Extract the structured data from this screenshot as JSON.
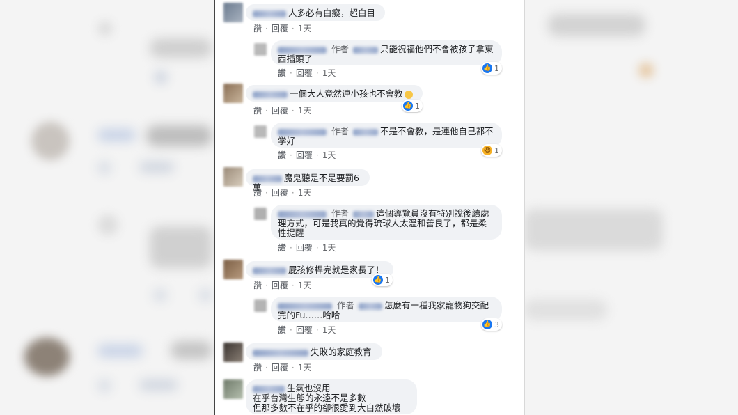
{
  "colors": {
    "like": "#1877f2",
    "haha": "#f7b125",
    "bubble": "#f0f2f5",
    "muted": "#65676b"
  },
  "actions": {
    "like": "讚",
    "reply": "回覆",
    "time": "1天",
    "sep": "·"
  },
  "author_badge": "作者",
  "comments": [
    {
      "text": "人多必有白癡，超白目"
    },
    {
      "text": "只能祝福他們不會被孩子拿東西插頭了",
      "reaction_count": "1"
    },
    {
      "text": "一個大人竟然連小孩也不會教",
      "reaction_count": "1"
    },
    {
      "text": "不是不會教，是連他自己都不学好",
      "reaction_count": "1"
    },
    {
      "text": "魔鬼聽是不是要罰6萬"
    },
    {
      "text": "這個導覽員沒有特別說後續處理方式，可是我真的覺得琉球人太溫和善良了，都是柔性提醒"
    },
    {
      "text": "屁孩修桿完就是家長了！",
      "reaction_count": "1"
    },
    {
      "text": "怎麼有一種我家寵物狗交配完的Fu……哈哈",
      "reaction_count": "3"
    },
    {
      "text": "失敗的家庭教育"
    },
    {
      "line1": "生氣也沒用",
      "line2": "在乎台灣生態的永遠不是多數",
      "line3": "但那多數不在乎的卻很愛到大自然破壞"
    }
  ]
}
